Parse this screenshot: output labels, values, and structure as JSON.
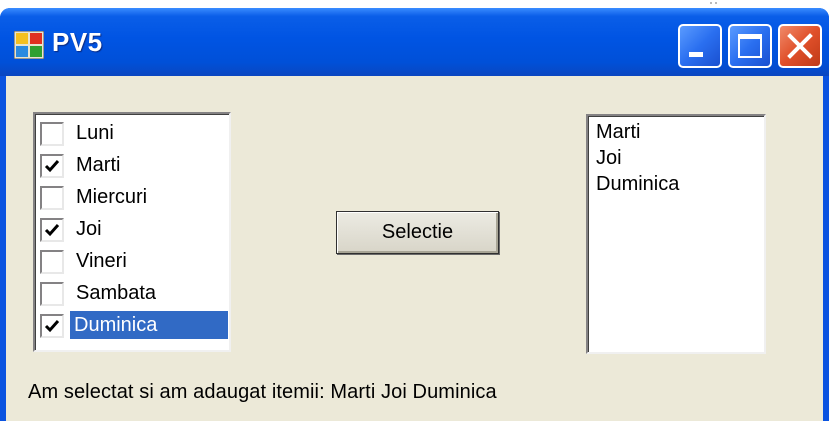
{
  "window": {
    "title": "PV5"
  },
  "checklist": {
    "items": [
      {
        "label": "Luni",
        "checked": false
      },
      {
        "label": "Marti",
        "checked": true
      },
      {
        "label": "Miercuri",
        "checked": false
      },
      {
        "label": "Joi",
        "checked": true
      },
      {
        "label": "Vineri",
        "checked": false
      },
      {
        "label": "Sambata",
        "checked": false
      },
      {
        "label": "Duminica",
        "checked": true,
        "selected": true
      }
    ]
  },
  "button": {
    "label": "Selectie"
  },
  "result_list": {
    "items": [
      "Marti",
      "Joi",
      "Duminica"
    ]
  },
  "status": {
    "text": "Am selectat si am adaugat itemii: Marti Joi Duminica"
  },
  "colors": {
    "titlebar": "#0054e3",
    "client": "#ece9d8",
    "selection": "#316ac5",
    "close_button": "#e0502a"
  }
}
